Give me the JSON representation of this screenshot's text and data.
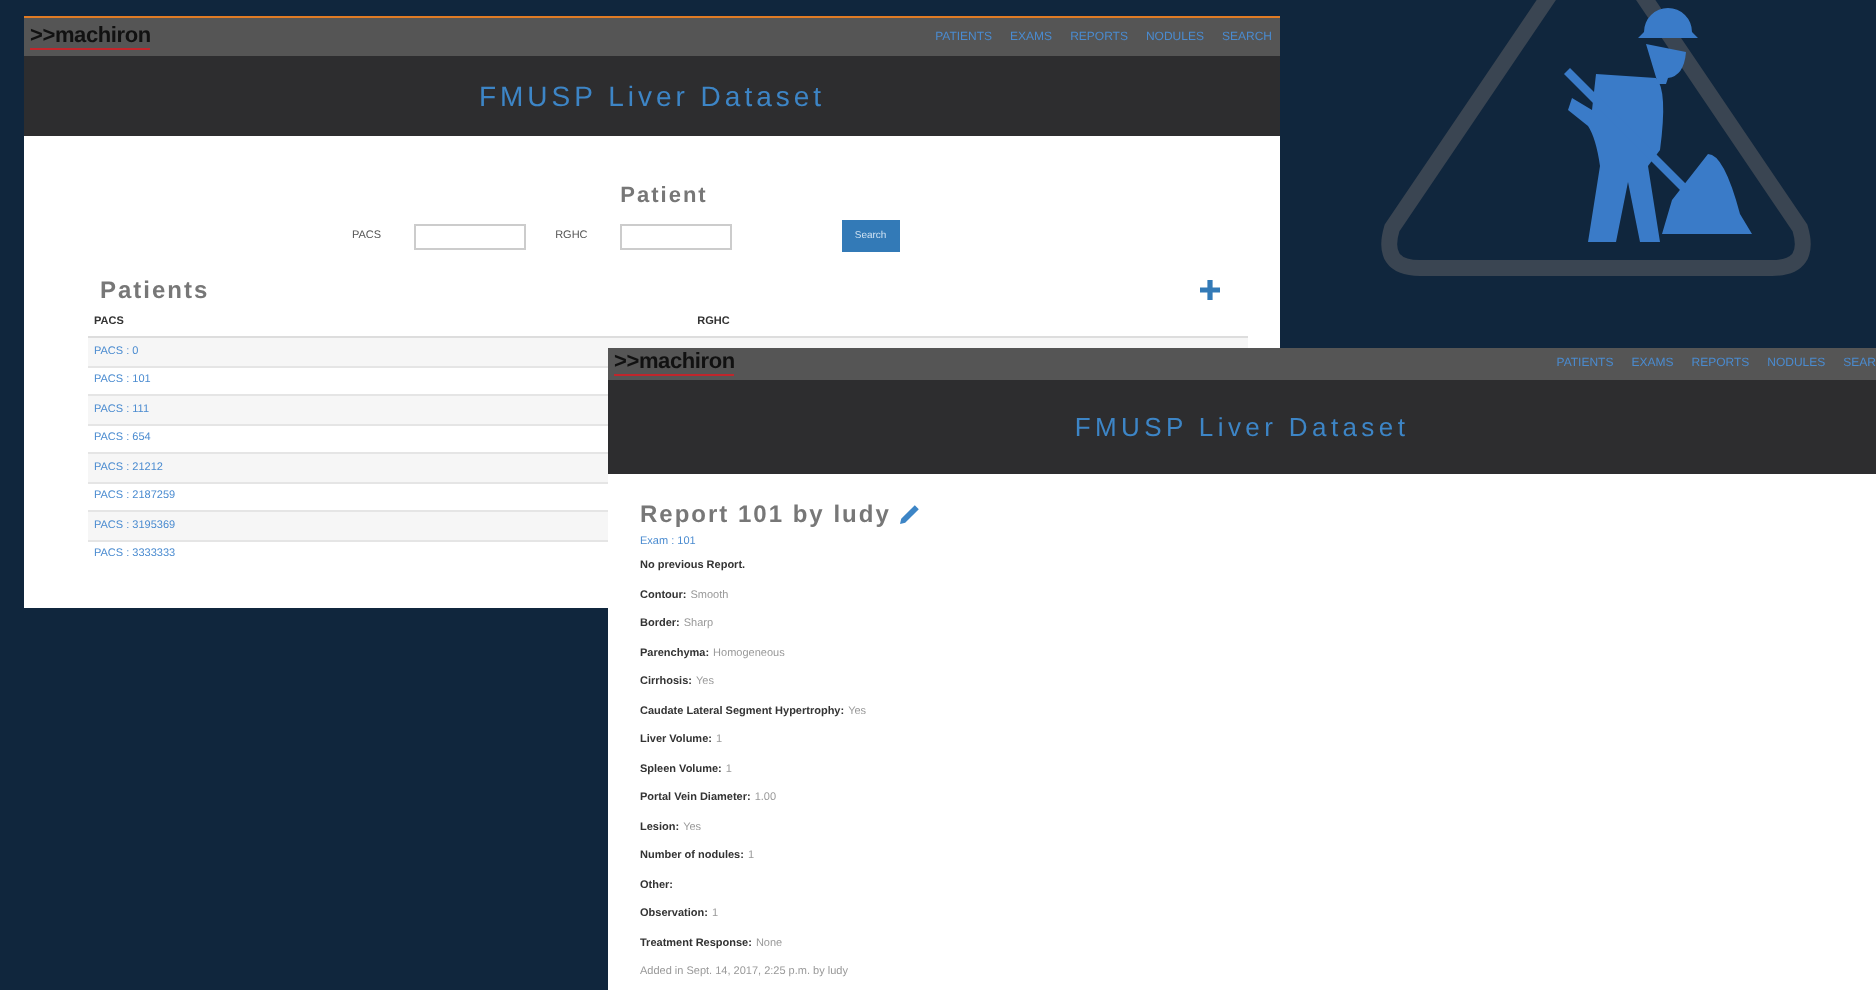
{
  "patients_window": {
    "logo": ">>machiron",
    "nav": [
      "PATIENTS",
      "EXAMS",
      "REPORTS",
      "NODULES",
      "SEARCH"
    ],
    "title": "FMUSP Liver Dataset",
    "search": {
      "heading": "Patient",
      "fields": [
        {
          "label": "PACS"
        },
        {
          "label": "RGHC"
        }
      ],
      "button": "Search"
    },
    "list_heading": "Patients",
    "table": {
      "columns": [
        "PACS",
        "RGHC"
      ],
      "rows": [
        {
          "pacs": "PACS : 0"
        },
        {
          "pacs": "PACS : 101"
        },
        {
          "pacs": "PACS : 111"
        },
        {
          "pacs": "PACS : 654"
        },
        {
          "pacs": "PACS : 21212"
        },
        {
          "pacs": "PACS : 2187259"
        },
        {
          "pacs": "PACS : 3195369"
        },
        {
          "pacs": "PACS : 3333333"
        }
      ]
    }
  },
  "report_window": {
    "logo": ">>machiron",
    "nav": [
      "PATIENTS",
      "EXAMS",
      "REPORTS",
      "NODULES",
      "SEAR"
    ],
    "title": "FMUSP Liver Dataset",
    "heading": "Report 101 by ludy",
    "exam_link": "Exam : 101",
    "note": "No previous Report.",
    "fields": [
      {
        "label": "Contour:",
        "value": "Smooth"
      },
      {
        "label": "Border:",
        "value": "Sharp"
      },
      {
        "label": "Parenchyma:",
        "value": "Homogeneous"
      },
      {
        "label": "Cirrhosis:",
        "value": "Yes"
      },
      {
        "label": "Caudate Lateral Segment Hypertrophy:",
        "value": "Yes"
      },
      {
        "label": "Liver Volume:",
        "value": "1"
      },
      {
        "label": "Spleen Volume:",
        "value": "1"
      },
      {
        "label": "Portal Vein Diameter:",
        "value": "1.00"
      },
      {
        "label": "Lesion:",
        "value": "Yes"
      },
      {
        "label": "Number of nodules:",
        "value": "1"
      },
      {
        "label": "Other:"
      },
      {
        "label": "Observation:",
        "value": "1"
      },
      {
        "label": "Treatment Response:",
        "value": "None"
      }
    ],
    "footer": "Added in Sept. 14, 2017, 2:25 p.m. by ludy"
  }
}
